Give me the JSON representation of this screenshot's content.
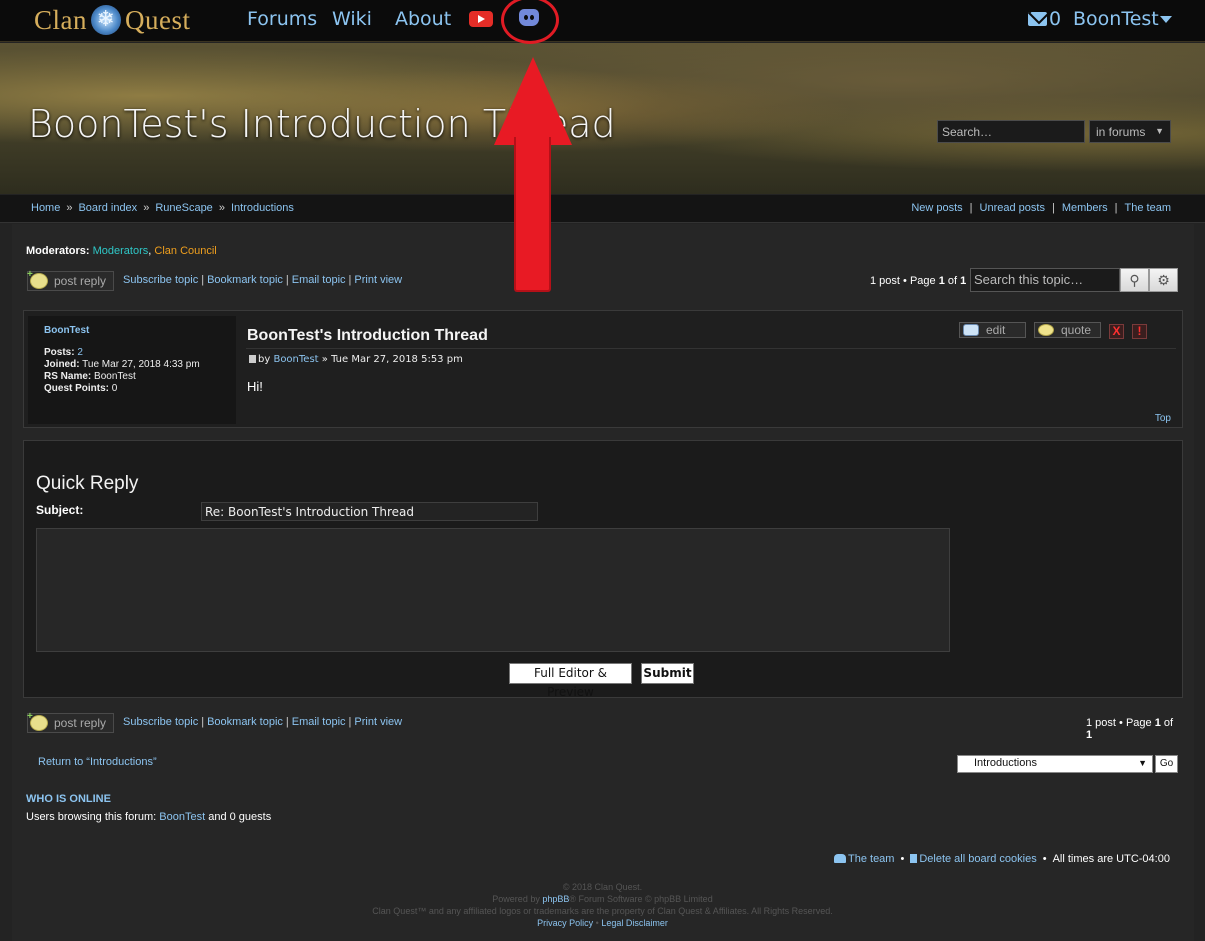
{
  "nav": {
    "logo_left": "Clan",
    "logo_right": "Quest",
    "links": [
      "Forums",
      "Wiki",
      "About"
    ],
    "mail_count": "0",
    "username": "BoonTest"
  },
  "banner": {
    "title": "BoonTest's Introduction Thread",
    "search_placeholder": "Search…",
    "search_scope": "in forums"
  },
  "breadcrumbs": [
    "Home",
    "Board index",
    "RuneScape",
    "Introductions"
  ],
  "quicklinks": [
    "New posts",
    "Unread posts",
    "Members",
    "The team"
  ],
  "moderators": {
    "label": "Moderators:",
    "groups": [
      "Moderators",
      "Clan Council"
    ]
  },
  "actions": {
    "post_reply": "post reply",
    "tools": [
      "Subscribe topic",
      "Bookmark topic",
      "Email topic",
      "Print view"
    ],
    "pagination_count": "1 post",
    "pagination_page": "Page",
    "pagination_current": "1",
    "pagination_of": "of",
    "pagination_total": "1",
    "topic_search_placeholder": "Search this topic…"
  },
  "post": {
    "author": "BoonTest",
    "posts_label": "Posts:",
    "posts_value": "2",
    "joined_label": "Joined:",
    "joined_value": "Tue Mar 27, 2018 4:33 pm",
    "rsname_label": "RS Name:",
    "rsname_value": "BoonTest",
    "qp_label": "Quest Points:",
    "qp_value": "0",
    "title": "BoonTest's Introduction Thread",
    "by": "by",
    "author_link": "BoonTest",
    "date": "» Tue Mar 27, 2018 5:53 pm",
    "content": "Hi!",
    "top_link": "Top",
    "edit": "edit",
    "quote": "quote",
    "delete": "X",
    "report": "!"
  },
  "quick_reply": {
    "title": "Quick Reply",
    "subject_label": "Subject:",
    "subject_value": "Re: BoonTest's Introduction Thread",
    "full_editor": "Full Editor & Preview",
    "submit": "Submit"
  },
  "lower": {
    "return_link": "Return to “Introductions”",
    "jumpbox_value": "Introductions",
    "go": "Go",
    "who_title": "WHO IS ONLINE",
    "who_prefix": "Users browsing this forum:",
    "who_user": "BoonTest",
    "who_suffix": "and 0 guests"
  },
  "footer": {
    "team": "The team",
    "delete_cookies": "Delete all board cookies",
    "timezone": "All times are UTC-04:00",
    "copyright_1": "© 2018 Clan Quest.",
    "powered_by": "Powered by",
    "phpbb": "phpBB",
    "forum_software": "® Forum Software © phpBB Limited",
    "copyright_3": "Clan Quest™ and any affiliated logos or trademarks are the property of Clan Quest & Affiliates. All Rights Reserved.",
    "privacy": "Privacy Policy",
    "legal": "Legal Disclaimer"
  },
  "colors": {
    "link": "#8cc4f0",
    "moderator": "#2fc7c7",
    "clan_council": "#ef9f1e",
    "annotation": "#e81a24",
    "discord": "#7289da",
    "youtube": "#e52d27"
  },
  "icons": [
    "youtube-icon",
    "discord-icon",
    "mail-icon",
    "caret-down-icon",
    "search-icon",
    "gear-icon",
    "reply-icon",
    "edit-icon",
    "quote-icon",
    "delete-icon",
    "report-icon",
    "post-icon",
    "team-icon",
    "trash-icon"
  ]
}
